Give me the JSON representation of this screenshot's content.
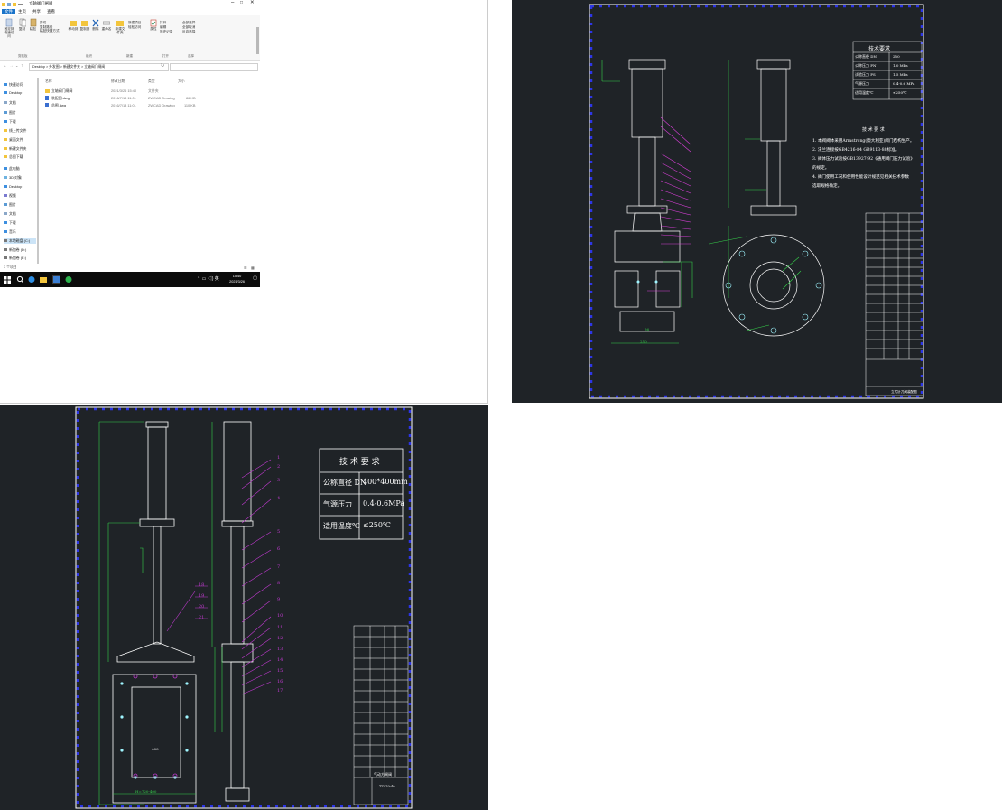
{
  "explorer": {
    "window_title": "立轴阀门闸阀",
    "tabs": [
      "文件",
      "主页",
      "共享",
      "查看"
    ],
    "ribbon": {
      "groups": [
        "剪贴板",
        "组织",
        "新建",
        "打开",
        "选择"
      ],
      "items": [
        "固定到快速访问",
        "复制",
        "粘贴",
        "剪切",
        "复制路径",
        "粘贴快捷方式",
        "移动到",
        "复制到",
        "删除",
        "重命名",
        "新建文件夹",
        "新建项目",
        "轻松访问",
        "属性",
        "打开",
        "编辑",
        "历史记录",
        "全部选择",
        "全部取消",
        "反向选择"
      ]
    },
    "address_path": [
      "Desktop",
      "外发图",
      "新建文件夹",
      "立轴阀门闸阀"
    ],
    "nav_items": [
      "快速访问",
      "Desktop",
      "文档",
      "图片",
      "下载",
      "线上传文件",
      "桌面文件",
      "新建文件夹",
      "总图下载",
      "此电脑",
      "3D 对象",
      "Desktop",
      "视频",
      "图片",
      "文档",
      "下载",
      "音乐",
      "本地磁盘 (C:)",
      "新加卷 (D:)",
      "新加卷 (E:)"
    ],
    "columns": [
      "名称",
      "修改日期",
      "类型",
      "大小"
    ],
    "files": [
      {
        "name": "立轴阀门闸阀",
        "date": "2021/3/26 15:40",
        "type": "文件夹",
        "size": ""
      },
      {
        "name": "装配图.dwg",
        "date": "2016/7/18 11:01",
        "type": "ZWCAD Drawing",
        "size": "86 KB"
      },
      {
        "name": "总图.dwg",
        "date": "2016/7/18 11:01",
        "type": "ZWCAD Drawing",
        "size": "110 KB"
      }
    ],
    "status": "3 个项目",
    "clock_time": "15:40",
    "clock_date": "2021/3/26"
  },
  "cad_top": {
    "tech_title": "技术要求",
    "tech_table": [
      [
        "公称直径 DN",
        "250"
      ],
      [
        "公称压力 PN",
        "1.0 MPa"
      ],
      [
        "试验压力 PS",
        "1.5 MPa"
      ],
      [
        "气源压力",
        "0.4-0.6 MPa"
      ],
      [
        "适用温度℃",
        "≤250℃"
      ]
    ],
    "notes_title": "技 术 要 求",
    "notes": [
      "1. 本阀阀体采用Armstrong(澳大利亚)阀门结构生产。",
      "2. 法兰连接按GB4216-84  GB9113-88标准。",
      "3. 阀体压力试验按GB13927-92《通用阀门压力试验》",
      "   的规定。",
      "4. 阀门使用工况和使用性能设计规范见相关技术参数",
      "   选取规格确定。"
    ],
    "dims": [
      "250",
      "56"
    ],
    "title_block": "立式针刀阀装配图"
  },
  "cad_bottom": {
    "tech_title": "技 术 要 求",
    "tech_table": [
      [
        "公称直径 DN",
        "400*400mm"
      ],
      [
        "气源压力",
        "0.4-0.6MPa"
      ],
      [
        "适用温度℃",
        "≤250℃"
      ]
    ],
    "balloons_right": [
      "1",
      "2",
      "3",
      "4",
      "5",
      "6",
      "7",
      "8",
      "9",
      "10",
      "11",
      "12",
      "13",
      "14",
      "15",
      "16",
      "17"
    ],
    "balloons_left": [
      "18",
      "19",
      "20",
      "21"
    ],
    "dims": [
      "400",
      "H=720-400"
    ],
    "title_block": "气动方闸阀",
    "drawing_no": "TZ470-40"
  }
}
